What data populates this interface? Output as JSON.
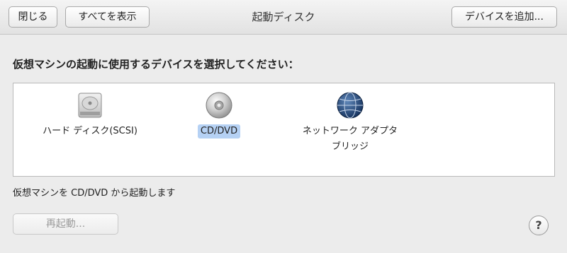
{
  "toolbar": {
    "close_label": "閉じる",
    "show_all_label": "すべてを表示",
    "title": "起動ディスク",
    "add_device_label": "デバイスを追加..."
  },
  "main": {
    "instruction": "仮想マシンの起動に使用するデバイスを選択してください：",
    "devices": [
      {
        "label": "ハード ディスク(SCSI)",
        "icon": "hard-disk-icon",
        "selected": false
      },
      {
        "label": "CD/DVD",
        "icon": "cd-dvd-icon",
        "selected": true
      },
      {
        "label": "ネットワーク アダプタ",
        "label2": "ブリッジ",
        "icon": "globe-network-icon",
        "selected": false
      }
    ],
    "status": "仮想マシンを CD/DVD から起動します",
    "restart_label": "再起動...",
    "help_label": "?"
  },
  "colors": {
    "selection": "#b5d1f4",
    "background": "#ececec"
  }
}
